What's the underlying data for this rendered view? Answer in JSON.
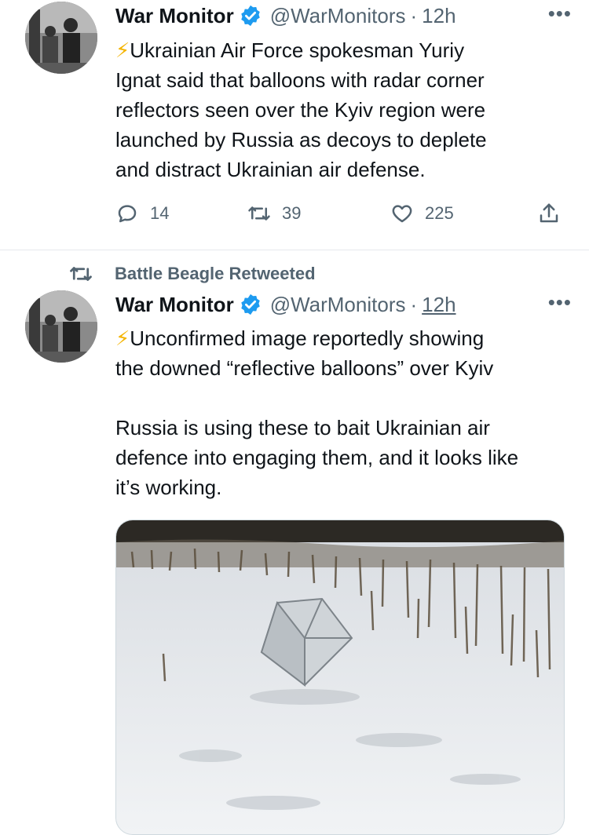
{
  "tweet1": {
    "name": "War Monitor",
    "handle": "@WarMonitors",
    "separator": "·",
    "time": "12h",
    "more": "•••",
    "emoji": "⚡",
    "text": "Ukrainian Air Force spokesman Yuriy\nIgnat said that balloons with radar corner\nreflectors seen over the Kyiv region were\nlaunched by Russia as decoys to deplete\nand distract Ukrainian air defense.",
    "replies": "14",
    "retweets": "39",
    "likes": "225"
  },
  "tweet2": {
    "retweeted_by": "Battle Beagle Retweeted",
    "name": "War Monitor",
    "handle": "@WarMonitors",
    "separator": "·",
    "time": "12h",
    "more": "•••",
    "emoji": "⚡",
    "text": "Unconfirmed image reportedly showing\nthe downed “reflective balloons” over Kyiv\n\nRussia is using these to bait Ukrainian air\ndefence into engaging them, and it looks like\nit’s working."
  },
  "colors": {
    "text": "#0f1419",
    "secondary": "#536471",
    "verified": "#1d9bf0",
    "bolt": "#f4b400"
  }
}
